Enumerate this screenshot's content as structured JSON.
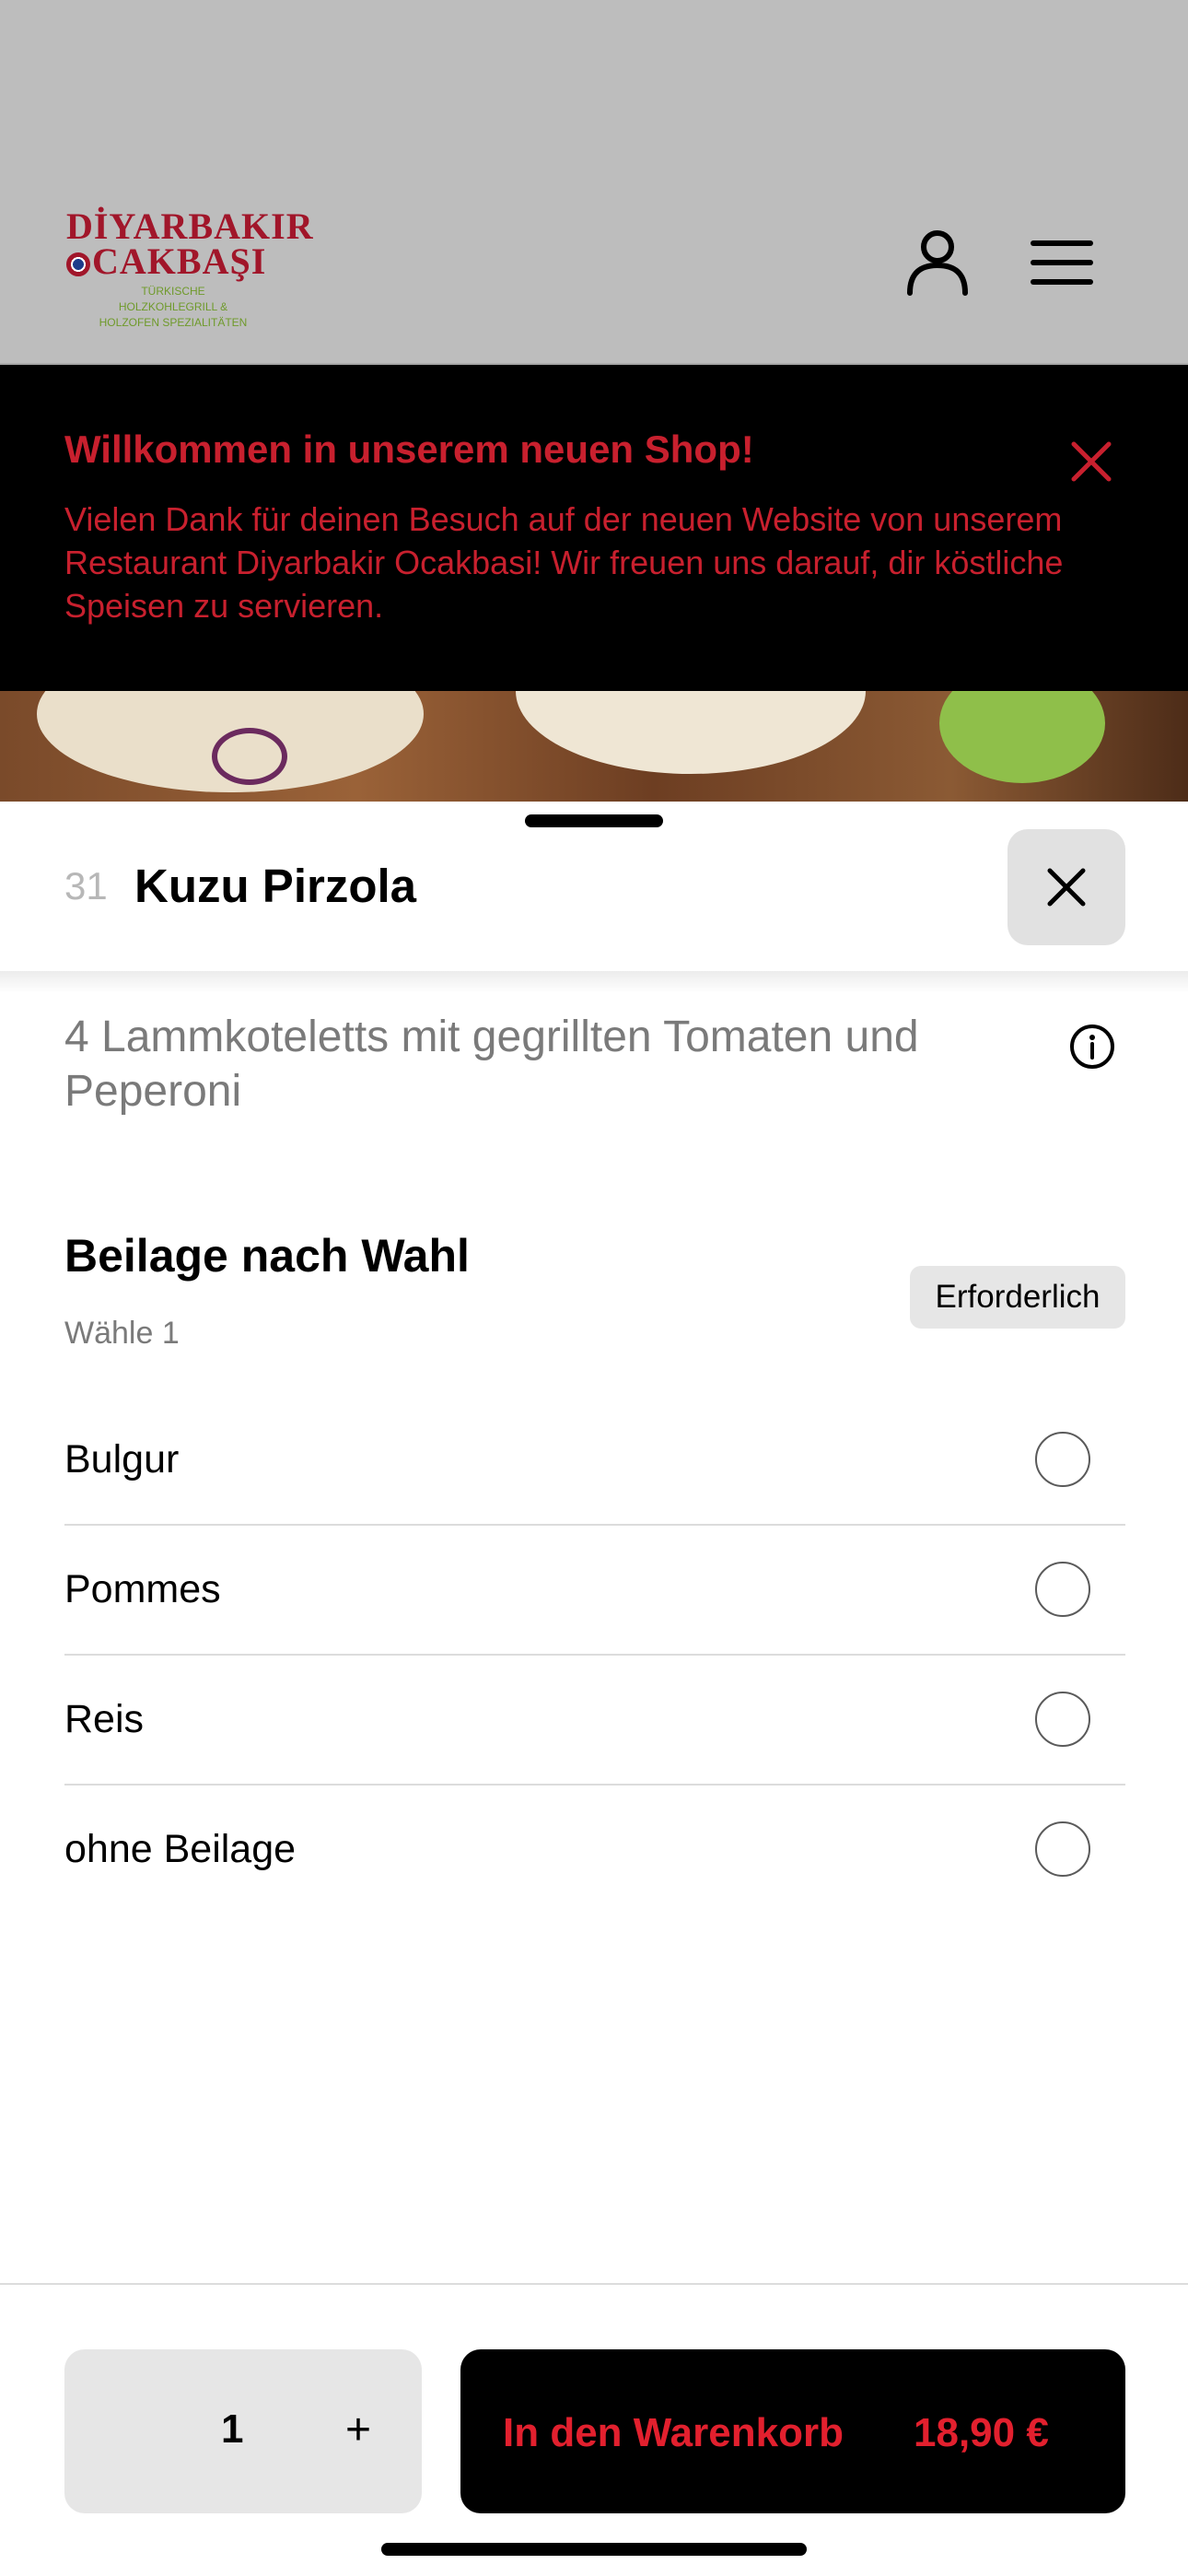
{
  "header": {
    "logo": {
      "line1": "DİYARBAKIR",
      "line2": "CAKBAŞI",
      "tagline": "TÜRKISCHE HOLZKOHLEGRILL & HOLZOFEN SPEZIALITÄTEN"
    },
    "icons": [
      "user-icon",
      "menu-icon"
    ]
  },
  "banner": {
    "title": "Willkommen in unserem neuen Shop!",
    "text": "Vielen Dank für deinen Besuch auf der neuen Website von unserem Restaurant Diyarbakir Ocakbasi! Wir freuen uns darauf, dir köstliche Speisen zu servieren.",
    "accent_color": "#c8202e"
  },
  "item": {
    "number": "31",
    "title": "Kuzu Pirzola",
    "description": "4 Lammkoteletts mit gegrillten Tomaten und Peperoni"
  },
  "option_group": {
    "title": "Beilage nach Wahl",
    "subtitle": "Wähle 1",
    "badge": "Erforderlich",
    "options": [
      {
        "label": "Bulgur",
        "selected": false
      },
      {
        "label": "Pommes",
        "selected": false
      },
      {
        "label": "Reis",
        "selected": false
      },
      {
        "label": "ohne Beilage",
        "selected": false
      }
    ]
  },
  "footer": {
    "quantity": "1",
    "plus": "+",
    "add_label": "In den Warenkorb",
    "price": "18,90 €"
  }
}
